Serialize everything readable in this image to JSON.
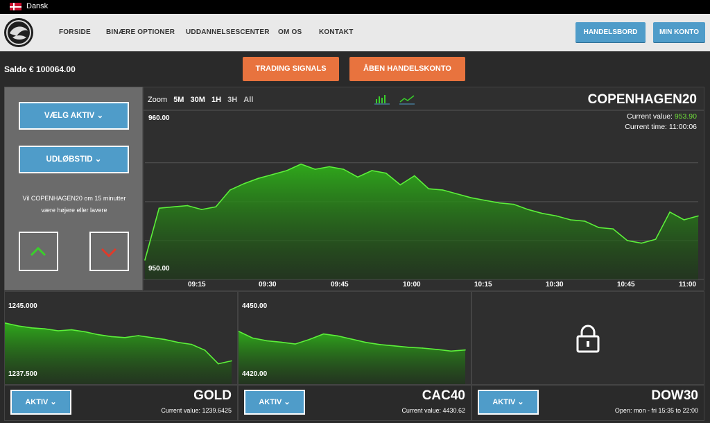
{
  "language": {
    "label": "Dansk"
  },
  "nav": {
    "items": [
      "FORSIDE",
      "BINÆRE OPTIONER",
      "UDDANNELSESCENTER",
      "OM OS",
      "KONTAKT"
    ]
  },
  "header_buttons": {
    "trading_desk": "HANDELSBORD",
    "my_account": "MIN KONTO"
  },
  "balance": "Saldo € 100064.00",
  "action_buttons": {
    "signals": "TRADING SIGNALS",
    "open_account": "ÅBEN HANDELSKONTO"
  },
  "left_panel": {
    "select_asset": "VÆLG AKTIV ⌄",
    "expiry": "UDLØBSTID ⌄",
    "question": "Vil COPENHAGEN20 om 15 minutter være højere eller lavere"
  },
  "main": {
    "zoom_label": "Zoom",
    "zoom_options": [
      "5M",
      "30M",
      "1H",
      "3H",
      "All"
    ],
    "title": "COPENHAGEN20",
    "current_value_label": "Current value: ",
    "current_value": "953.90",
    "current_time_label": "Current time: ",
    "current_time": "11:00:06",
    "y_top": "960.00",
    "y_bottom": "950.00",
    "x_ticks": [
      "09:15",
      "09:30",
      "09:45",
      "10:00",
      "10:15",
      "10:30",
      "10:45",
      "11:00"
    ]
  },
  "panels": [
    {
      "name": "GOLD",
      "aktiv": "AKTIV ⌄",
      "info": "Current value: 1239.6425",
      "y_top": "1245.000",
      "y_bottom": "1237.500"
    },
    {
      "name": "CAC40",
      "aktiv": "AKTIV ⌄",
      "info": "Current value: 4430.62",
      "y_top": "4450.00",
      "y_bottom": "4420.00"
    },
    {
      "name": "DOW30",
      "aktiv": "AKTIV ⌄",
      "info": "Open: mon - fri 15:35 to 22:00"
    }
  ],
  "colors": {
    "accent_blue": "#4f9cc9",
    "accent_orange": "#e8733e",
    "chart_green": "#5cf03a",
    "value_green": "#6fe03a"
  },
  "chart_data": [
    {
      "type": "area",
      "title": "COPENHAGEN20",
      "x": [
        "09:03",
        "09:06",
        "09:09",
        "09:12",
        "09:15",
        "09:18",
        "09:21",
        "09:24",
        "09:27",
        "09:30",
        "09:33",
        "09:36",
        "09:39",
        "09:42",
        "09:45",
        "09:48",
        "09:51",
        "09:54",
        "09:57",
        "10:00",
        "10:03",
        "10:06",
        "10:09",
        "10:12",
        "10:15",
        "10:18",
        "10:21",
        "10:24",
        "10:27",
        "10:30",
        "10:33",
        "10:36",
        "10:39",
        "10:42",
        "10:45",
        "10:48",
        "10:51",
        "10:54",
        "10:57",
        "11:00"
      ],
      "values": [
        950.5,
        954.5,
        954.6,
        954.7,
        954.4,
        954.6,
        955.9,
        956.4,
        956.8,
        957.1,
        957.4,
        957.9,
        957.5,
        957.7,
        957.5,
        956.9,
        957.4,
        957.2,
        956.3,
        957.0,
        956.0,
        955.9,
        955.6,
        955.3,
        955.1,
        954.9,
        954.8,
        954.4,
        954.1,
        953.9,
        953.6,
        953.5,
        953.0,
        952.9,
        952.0,
        951.8,
        952.1,
        954.2,
        953.6,
        953.9
      ],
      "ylim": [
        949.0,
        962.0
      ],
      "y_ticks": [
        "960.00",
        "950.00"
      ],
      "x_ticks": [
        "09:15",
        "09:30",
        "09:45",
        "10:00",
        "10:15",
        "10:30",
        "10:45",
        "11:00"
      ],
      "grid": true
    },
    {
      "type": "area",
      "title": "GOLD",
      "values": [
        1242.8,
        1242.5,
        1242.3,
        1242.2,
        1242.0,
        1242.1,
        1241.9,
        1241.6,
        1241.4,
        1241.3,
        1241.5,
        1241.3,
        1241.1,
        1240.8,
        1240.6,
        1240.0,
        1238.6,
        1238.9
      ],
      "ylim": [
        1236.5,
        1246.0
      ],
      "y_ticks": [
        "1245.000",
        "1237.500"
      ]
    },
    {
      "type": "area",
      "title": "CAC40",
      "values": [
        4437.5,
        4435.0,
        4434.0,
        4433.5,
        4432.8,
        4434.5,
        4436.5,
        4435.8,
        4434.6,
        4433.4,
        4432.6,
        4432.1,
        4431.6,
        4431.3,
        4430.8,
        4430.2,
        4430.6
      ],
      "ylim": [
        4418.0,
        4452.0
      ],
      "y_ticks": [
        "4450.00",
        "4420.00"
      ]
    }
  ]
}
